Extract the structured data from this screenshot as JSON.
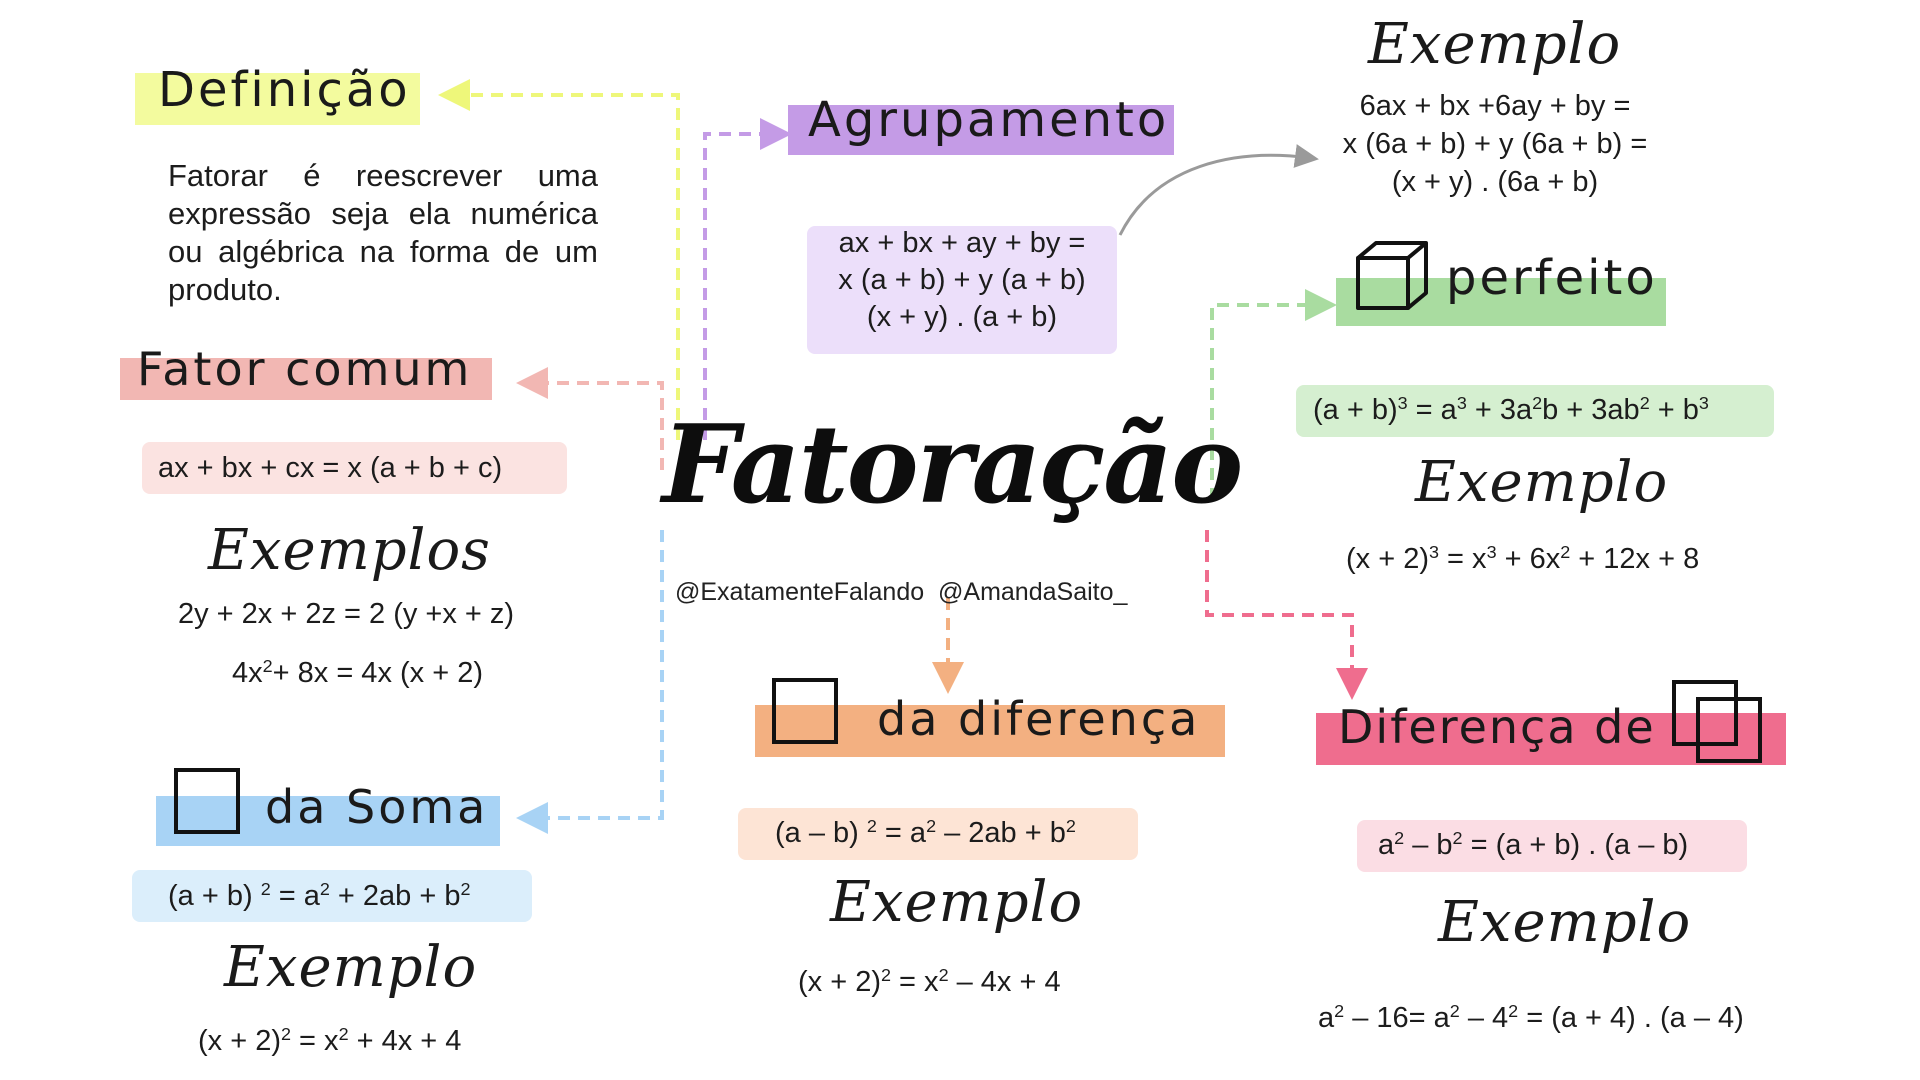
{
  "title": "Fatoração",
  "credits": "@ExatamenteFalando  @AmandaSaito_",
  "colors": {
    "definicao": "#f3fb9e",
    "agrupamento": "#c49be6",
    "agrupamento_light": "#ecdffa",
    "fator_comum": "#f2b7b3",
    "fator_comum_light": "#fbe3e1",
    "cubo": "#a9dca0",
    "cubo_light": "#d5efd0",
    "soma": "#a8d3f5",
    "soma_light": "#dbeefb",
    "diferenca": "#f3b081",
    "diferenca_light": "#fde4d5",
    "dif_quadrados": "#ef6d8e",
    "dif_quadrados_light": "#fbdde4",
    "curve_arrow": "#9a9a9a"
  },
  "definicao": {
    "heading": "Definição",
    "text": "Fatorar é reescrever uma expressão seja ela numérica ou algébrica na forma de um produto."
  },
  "agrupamento": {
    "heading": "Agrupamento",
    "formula_lines": [
      "ax + bx + ay + by =",
      "x (a + b) + y (a + b)",
      "(x + y) . (a + b)"
    ]
  },
  "exemplo_agrupamento": {
    "heading": "Exemplo",
    "lines": [
      "6ax + bx +6ay + by =",
      "x (6a + b) + y (6a + b) =",
      "(x + y) . (6a + b)"
    ]
  },
  "fator_comum": {
    "heading": "Fator comum",
    "formula": "ax + bx + cx  = x (a + b + c)",
    "examples_heading": "Exemplos",
    "example1": "2y + 2x + 2z = 2 (y +x + z)",
    "example2": "4x²+ 8x = 4x (x + 2)"
  },
  "cubo_perfeito": {
    "heading": "perfeito",
    "icon": "cube-icon",
    "formula": "(a + b)³ = a³ + 3a²b + 3ab² + b³",
    "example_heading": "Exemplo",
    "example": "(x + 2)³ = x³ + 6x² + 12x + 8"
  },
  "quadrado_soma": {
    "heading": "da Soma",
    "icon": "square-icon",
    "formula": "(a + b) ² = a² + 2ab + b²",
    "example_heading": "Exemplo",
    "example": "(x  + 2)² = x² + 4x + 4"
  },
  "quadrado_diferenca": {
    "heading": "da diferença",
    "icon": "square-icon",
    "formula": "(a – b) ² = a² – 2ab + b²",
    "example_heading": "Exemplo",
    "example": "(x  + 2)² = x² – 4x + 4"
  },
  "diferenca_quadrados": {
    "heading": "Diferença de",
    "icon": "overlapping-squares-icon",
    "formula": "a² – b² = (a + b) . (a – b)",
    "example_heading": "Exemplo",
    "example": "a² – 16= a² – 4² = (a + 4) . (a – 4)"
  }
}
